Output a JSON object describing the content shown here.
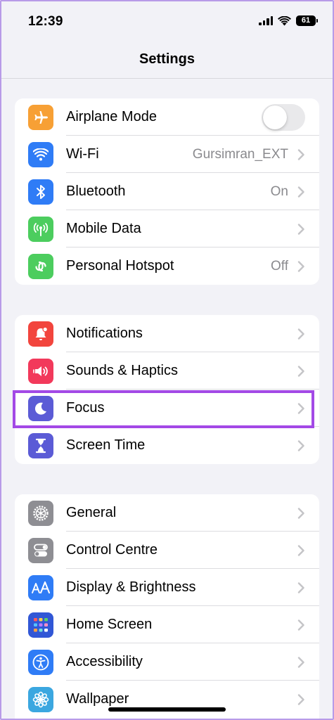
{
  "status_bar": {
    "time": "12:39",
    "battery": "61"
  },
  "nav": {
    "title": "Settings"
  },
  "groups": [
    {
      "items": [
        {
          "label": "Airplane Mode",
          "icon": "airplane-icon",
          "color": "#f7a035",
          "toggle": false
        },
        {
          "label": "Wi-Fi",
          "value": "Gursimran_EXT",
          "icon": "wifi-icon",
          "color": "#2f7cf6"
        },
        {
          "label": "Bluetooth",
          "value": "On",
          "icon": "bluetooth-icon",
          "color": "#2f7cf6"
        },
        {
          "label": "Mobile Data",
          "icon": "antenna-icon",
          "color": "#4ccd5e"
        },
        {
          "label": "Personal Hotspot",
          "value": "Off",
          "icon": "hotspot-icon",
          "color": "#4ccd5e"
        }
      ]
    },
    {
      "items": [
        {
          "label": "Notifications",
          "icon": "bell-icon",
          "color": "#f2453d"
        },
        {
          "label": "Sounds & Haptics",
          "icon": "speaker-icon",
          "color": "#f2395b"
        },
        {
          "label": "Focus",
          "icon": "moon-icon",
          "color": "#5b5bd6",
          "highlighted": true
        },
        {
          "label": "Screen Time",
          "icon": "hourglass-icon",
          "color": "#5b5bd6"
        }
      ]
    },
    {
      "items": [
        {
          "label": "General",
          "icon": "gear-icon",
          "color": "#8e8e93"
        },
        {
          "label": "Control Centre",
          "icon": "switches-icon",
          "color": "#8e8e93"
        },
        {
          "label": "Display & Brightness",
          "icon": "text-size-icon",
          "color": "#2f7cf6"
        },
        {
          "label": "Home Screen",
          "icon": "app-grid-icon",
          "color": "#3157d6"
        },
        {
          "label": "Accessibility",
          "icon": "accessibility-icon",
          "color": "#2f7cf6"
        },
        {
          "label": "Wallpaper",
          "icon": "flower-icon",
          "color": "#3ba7e0"
        }
      ]
    }
  ],
  "colors": {
    "highlight": "#a349e6",
    "background": "#f2f2f7"
  }
}
